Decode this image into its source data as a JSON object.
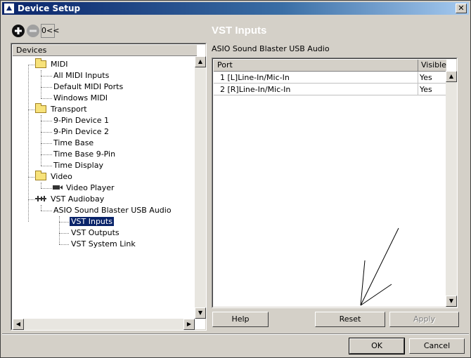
{
  "window": {
    "title": "Device Setup"
  },
  "toolbar": {
    "reset_label": "0<<"
  },
  "heading": "VST Inputs",
  "devices": {
    "header": "Devices",
    "tree": [
      {
        "label": "MIDI"
      },
      {
        "label": "All MIDI Inputs"
      },
      {
        "label": "Default MIDI Ports"
      },
      {
        "label": "Windows MIDI"
      },
      {
        "label": "Transport"
      },
      {
        "label": "9-Pin Device 1"
      },
      {
        "label": "9-Pin Device 2"
      },
      {
        "label": "Time Base"
      },
      {
        "label": "Time Base 9-Pin"
      },
      {
        "label": "Time Display"
      },
      {
        "label": "Video"
      },
      {
        "label": "Video Player"
      },
      {
        "label": "VST Audiobay"
      },
      {
        "label": "ASIO Sound Blaster USB Audio"
      },
      {
        "label": "VST Inputs"
      },
      {
        "label": "VST Outputs"
      },
      {
        "label": "VST System Link"
      }
    ]
  },
  "device_name": "ASIO Sound Blaster USB Audio",
  "ports_table": {
    "columns": [
      "Port",
      "Visible"
    ],
    "rows": [
      [
        "1 [L]Line-In/Mic-In",
        "Yes"
      ],
      [
        "2 [R]Line-In/Mic-In",
        "Yes"
      ]
    ]
  },
  "buttons": {
    "help": "Help",
    "reset": "Reset",
    "apply": "Apply",
    "ok": "OK",
    "cancel": "Cancel"
  },
  "colors": {
    "title_bar": "#0a246a",
    "selection": "#0a246a",
    "dialog_bg": "#d4d0c8"
  }
}
